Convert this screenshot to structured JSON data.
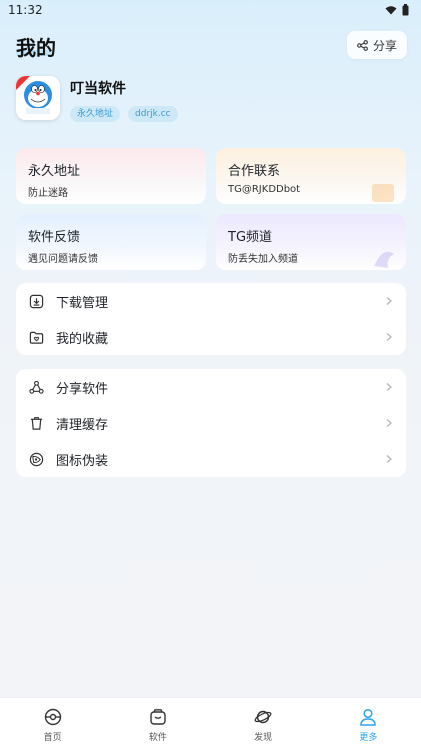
{
  "status": {
    "time": "11:32"
  },
  "header": {
    "title": "我的",
    "share_label": "分享"
  },
  "profile": {
    "name": "叮当软件",
    "tags": [
      "永久地址",
      "ddrjk.cc"
    ],
    "icon_text": "ddrjk.cc"
  },
  "cards": [
    {
      "title": "永久地址",
      "sub": "防止迷路"
    },
    {
      "title": "合作联系",
      "sub": "TG@RJKDDbot"
    },
    {
      "title": "软件反馈",
      "sub": "遇见问题请反馈"
    },
    {
      "title": "TG频道",
      "sub": "防丢失加入频道"
    }
  ],
  "menu_group1": [
    {
      "label": "下载管理",
      "icon": "download-icon"
    },
    {
      "label": "我的收藏",
      "icon": "folder-heart-icon"
    }
  ],
  "menu_group2": [
    {
      "label": "分享软件",
      "icon": "share-nodes-icon"
    },
    {
      "label": "清理缓存",
      "icon": "trash-icon"
    },
    {
      "label": "图标伪装",
      "icon": "disguise-icon"
    }
  ],
  "tabbar": [
    {
      "label": "首页",
      "icon": "home-icon",
      "active": false
    },
    {
      "label": "软件",
      "icon": "apps-bag-icon",
      "active": false
    },
    {
      "label": "发现",
      "icon": "planet-icon",
      "active": false
    },
    {
      "label": "更多",
      "icon": "user-icon",
      "active": true
    }
  ],
  "colors": {
    "accent": "#2aa3f0",
    "tag_bg": "#cde9f8",
    "tag_text": "#3a9ad0"
  }
}
